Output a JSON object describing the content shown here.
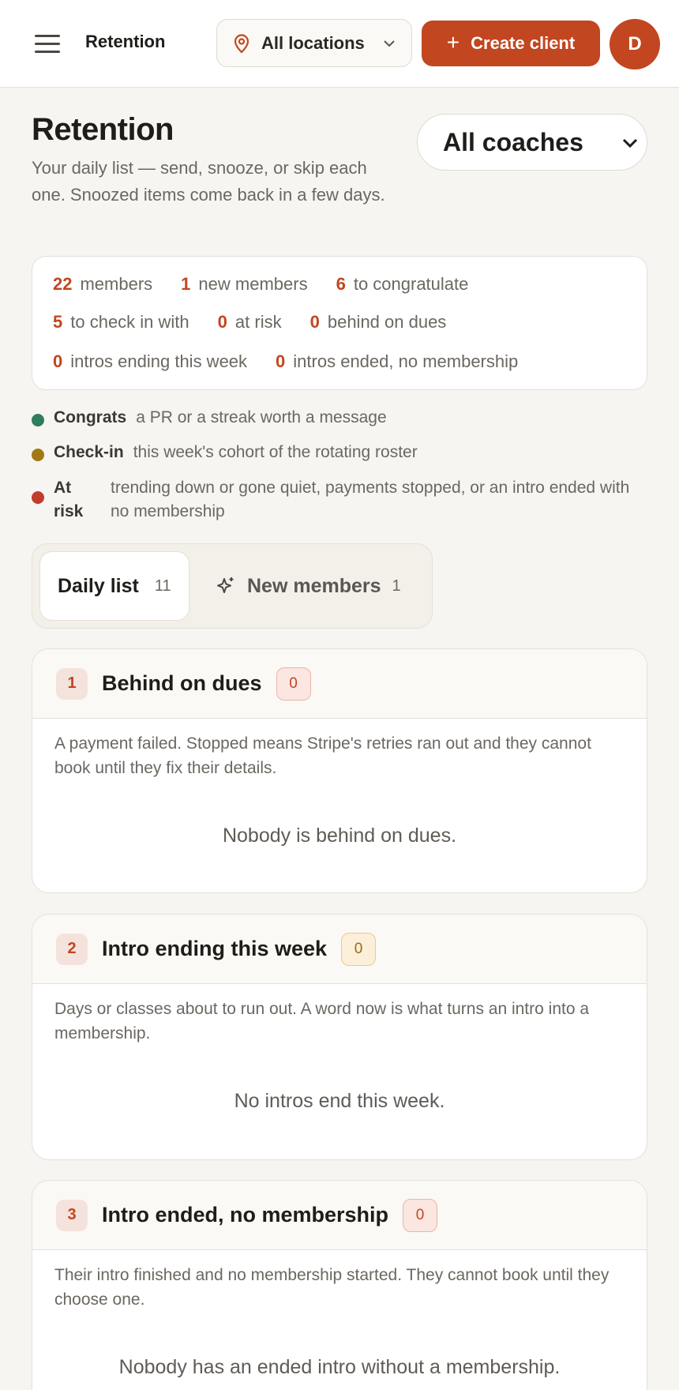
{
  "topbar": {
    "title": "Retention",
    "location_label": "All locations",
    "create_label": "Create client",
    "avatar_initial": "D"
  },
  "header": {
    "title": "Retention",
    "subtitle": "Your daily list — send, snooze, or skip each one. Snoozed items come back in a few days.",
    "coach_filter": "All coaches"
  },
  "stats": [
    {
      "value": "22",
      "label": "members"
    },
    {
      "value": "1",
      "label": "new members"
    },
    {
      "value": "6",
      "label": "to congratulate"
    },
    {
      "value": "5",
      "label": "to check in with"
    },
    {
      "value": "0",
      "label": "at risk"
    },
    {
      "value": "0",
      "label": "behind on dues"
    },
    {
      "value": "0",
      "label": "intros ending this week"
    },
    {
      "value": "0",
      "label": "intros ended, no membership"
    }
  ],
  "legend": [
    {
      "key": "Congrats",
      "desc": "a PR or a streak worth a message",
      "color": "#2e7d5b"
    },
    {
      "key": "Check-in",
      "desc": "this week's cohort of the rotating roster",
      "color": "#a27812"
    },
    {
      "key": "At risk",
      "desc": "trending down or gone quiet, payments stopped, or an intro ended with no membership",
      "color": "#c23b2c"
    }
  ],
  "tabs": [
    {
      "label": "Daily list",
      "count": "11"
    },
    {
      "label": "New members",
      "count": "1"
    }
  ],
  "sections": [
    {
      "number": "1",
      "title": "Behind on dues",
      "count": "0",
      "desc": "A payment failed. Stopped means Stripe's retries ran out and they cannot book until they fix their details.",
      "empty": "Nobody is behind on dues."
    },
    {
      "number": "2",
      "title": "Intro ending this week",
      "count": "0",
      "desc": "Days or classes about to run out. A word now is what turns an intro into a membership.",
      "empty": "No intros end this week."
    },
    {
      "number": "3",
      "title": "Intro ended, no membership",
      "count": "0",
      "desc": "Their intro finished and no membership started. They cannot book until they choose one.",
      "empty": "Nobody has an ended intro without a membership."
    }
  ],
  "colors": {
    "accent": "#c2461f",
    "background": "#f7f5f1"
  }
}
